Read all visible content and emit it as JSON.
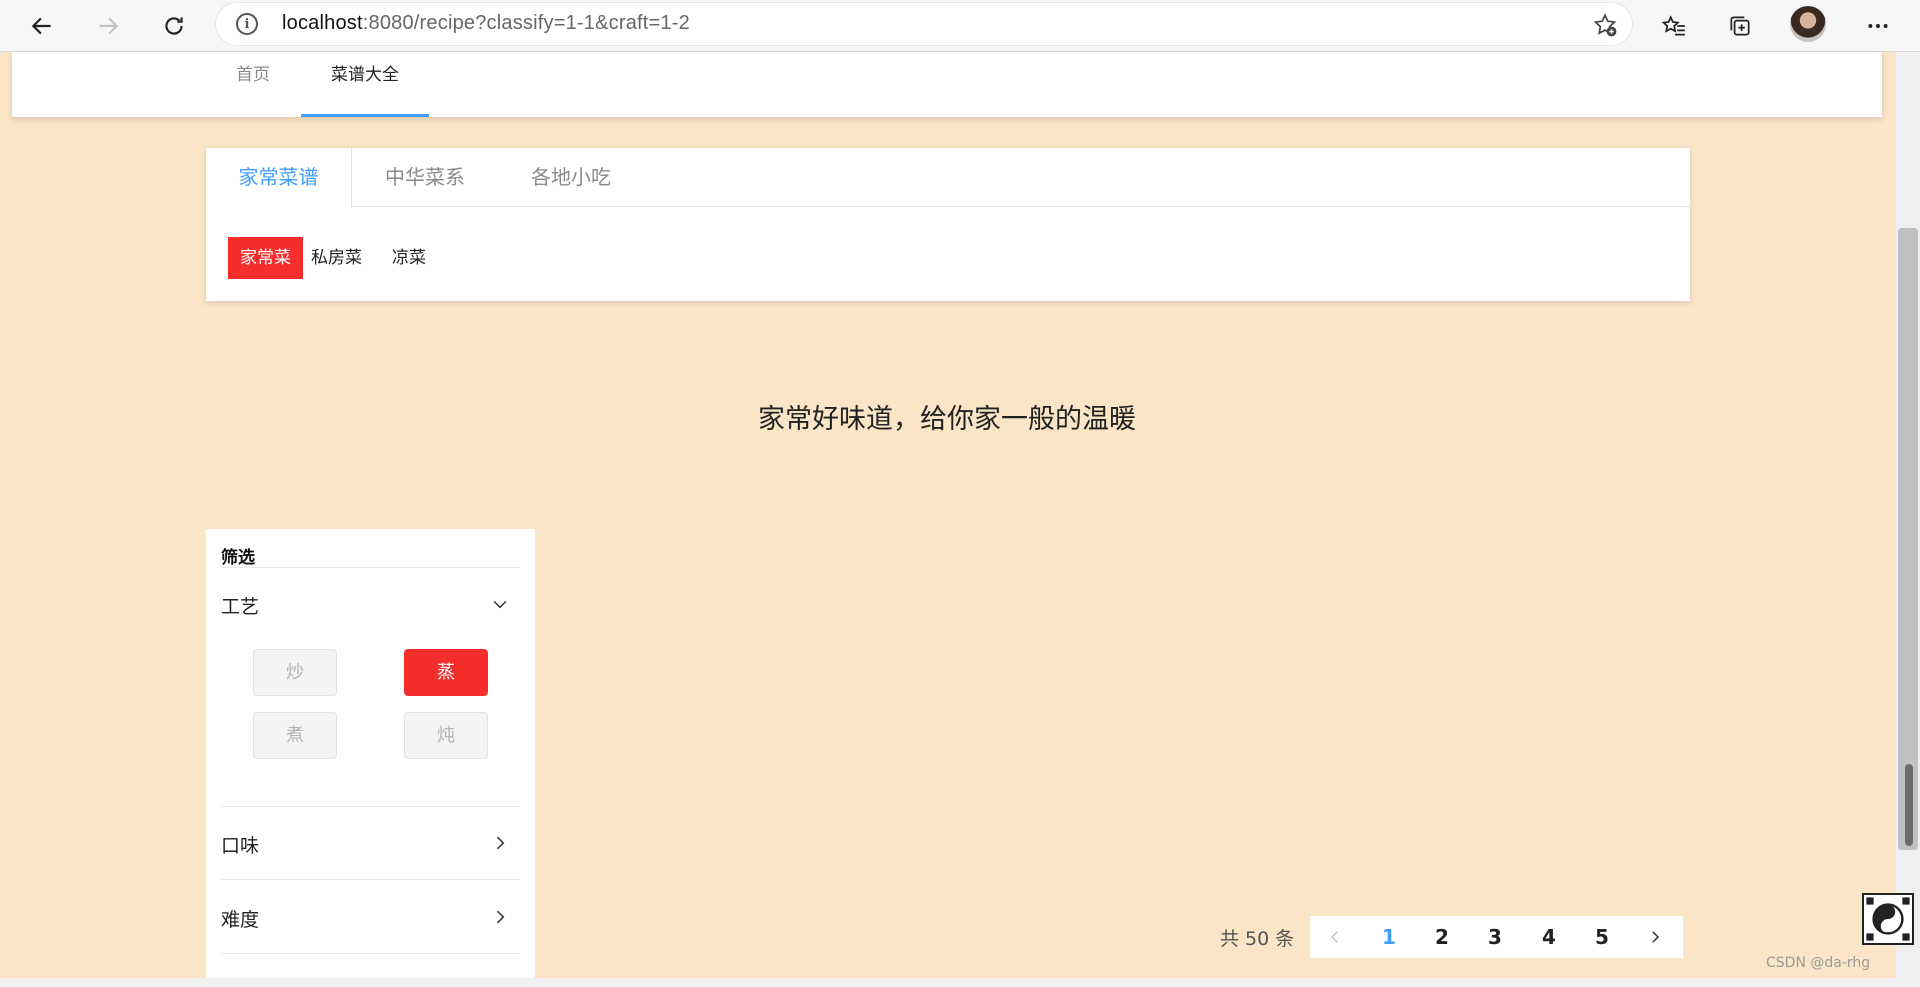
{
  "browser": {
    "url_host": "localhost",
    "url_rest": ":8080/recipe?classify=1-1&craft=1-2",
    "icons": [
      "back-icon",
      "forward-icon",
      "refresh-icon",
      "info-icon",
      "add-favorite-icon",
      "favorites-icon",
      "collections-icon",
      "more-icon"
    ]
  },
  "header": {
    "nav": [
      {
        "label": "首页"
      },
      {
        "label": "菜谱大全"
      }
    ]
  },
  "category": {
    "tabs": [
      {
        "label": "家常菜谱"
      },
      {
        "label": "中华菜系"
      },
      {
        "label": "各地小吃"
      }
    ],
    "subtags": [
      {
        "label": "家常菜"
      },
      {
        "label": "私房菜"
      },
      {
        "label": "凉菜"
      }
    ],
    "active_color": "#f62d2d",
    "tab_active_color": "#409eff"
  },
  "slogan": "家常好味道，给你家一般的温暖",
  "filter": {
    "title": "筛选",
    "sections": [
      {
        "label": "工艺",
        "expanded": true,
        "options": [
          {
            "label": "炒"
          },
          {
            "label": "蒸"
          },
          {
            "label": "煮"
          },
          {
            "label": "炖"
          }
        ]
      },
      {
        "label": "口味",
        "expanded": false
      },
      {
        "label": "难度",
        "expanded": false
      }
    ]
  },
  "pagination": {
    "total_text": "共 50 条",
    "pages": [
      "1",
      "2",
      "3",
      "4",
      "5"
    ],
    "current": "1"
  },
  "watermark": "CSDN @da-rhg",
  "page_background": "#fae6c6"
}
